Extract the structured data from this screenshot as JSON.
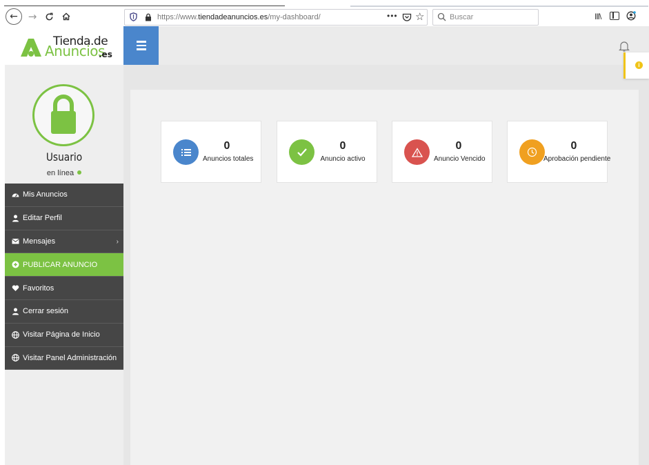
{
  "browser": {
    "url_prefix": "https://www.",
    "url_host": "tiendadeanuncios.es",
    "url_path": "/my-dashboard/",
    "more_label": "•••",
    "search_placeholder": "Buscar",
    "library_label": "III\\"
  },
  "logo": {
    "line1": "Tienda.de",
    "line2": "Anuncios",
    "suffix": ".es",
    "brand_color": "#7cc243"
  },
  "profile": {
    "name": "Usuario",
    "status": "en línea"
  },
  "sidebar": {
    "items": [
      {
        "label": "Mis Anuncios",
        "icon": "dashboard-icon"
      },
      {
        "label": "Editar Perfil",
        "icon": "user-icon"
      },
      {
        "label": "Mensajes",
        "icon": "envelope-icon",
        "has_submenu": true
      },
      {
        "label": "PUBLICAR ANUNCIO",
        "icon": "plus-circle-icon",
        "active": true
      },
      {
        "label": "Favoritos",
        "icon": "heart-icon"
      },
      {
        "label": "Cerrar sesión",
        "icon": "user-icon"
      },
      {
        "label": "Visitar Página de Inicio",
        "icon": "globe-icon"
      },
      {
        "label": "Visitar Panel Administración",
        "icon": "globe-icon"
      }
    ]
  },
  "stats": [
    {
      "value": "0",
      "label": "Anuncios totales",
      "icon": "list-icon",
      "color": "#4a86cc"
    },
    {
      "value": "0",
      "label": "Anuncio activo",
      "icon": "check-icon",
      "color": "#7cc243"
    },
    {
      "value": "0",
      "label": "Anuncio Vencido",
      "icon": "warning-icon",
      "color": "#d9534f"
    },
    {
      "value": "0",
      "label": "Aprobación pendiente",
      "icon": "clock-icon",
      "color": "#f0a020"
    }
  ],
  "colors": {
    "accent": "#4a86cc",
    "sidebar_dark": "#464646",
    "active": "#7cc243",
    "warning": "#f0c419"
  }
}
